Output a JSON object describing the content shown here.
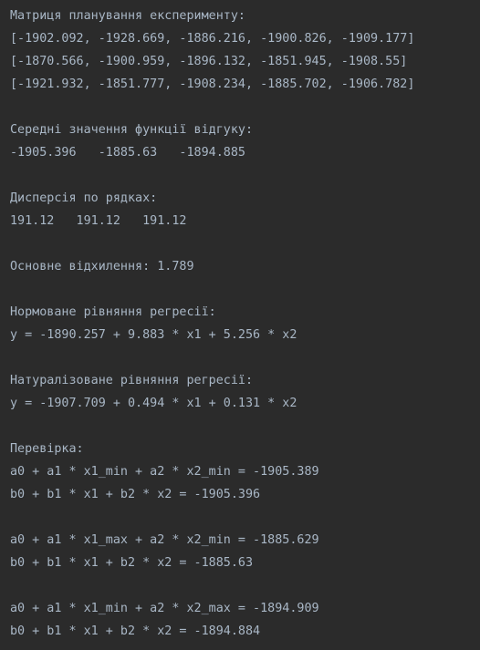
{
  "console": {
    "matrix_title": "Матриця планування експерименту:",
    "matrix_rows": [
      "[-1902.092, -1928.669, -1886.216, -1900.826, -1909.177]",
      "[-1870.566, -1900.959, -1896.132, -1851.945, -1908.55]",
      "[-1921.932, -1851.777, -1908.234, -1885.702, -1906.782]"
    ],
    "mean_title": "Середні значення функції відгуку:",
    "mean_values": "-1905.396   -1885.63   -1894.885",
    "dispersion_title": "Дисперсія по рядках:",
    "dispersion_values": "191.12   191.12   191.12",
    "deviation": "Основне відхилення: 1.789",
    "normalized_title": "Нормоване рівняння регресії:",
    "normalized_equation": "y = -1890.257 + 9.883 * x1 + 5.256 * x2",
    "naturalized_title": "Натуралізоване рівняння регресії:",
    "naturalized_equation": "y = -1907.709 + 0.494 * x1 + 0.131 * x2",
    "check_title": "Перевірка:",
    "checks": [
      {
        "a": "a0 + a1 * x1_min + a2 * x2_min = -1905.389",
        "b": "b0 + b1 * x1 + b2 * x2 = -1905.396"
      },
      {
        "a": "a0 + a1 * x1_max + a2 * x2_min = -1885.629",
        "b": "b0 + b1 * x1 + b2 * x2 = -1885.63"
      },
      {
        "a": "a0 + a1 * x1_min + a2 * x2_max = -1894.909",
        "b": "b0 + b1 * x1 + b2 * x2 = -1894.884"
      }
    ]
  },
  "colors": {
    "background": "#2b2b2b",
    "text": "#a9b7c6"
  }
}
